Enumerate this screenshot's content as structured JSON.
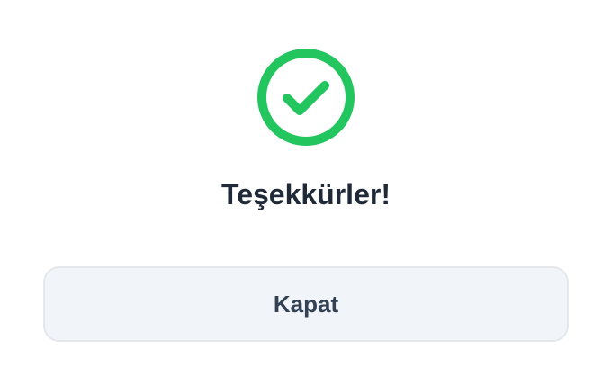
{
  "dialog": {
    "icon": "check-circle-icon",
    "title": "Teşekkürler!",
    "close_label": "Kapat"
  },
  "colors": {
    "success": "#22c55e",
    "title_text": "#1f2937",
    "button_bg": "#f1f4f8",
    "button_border": "#e5e7eb",
    "button_text": "#334155"
  }
}
